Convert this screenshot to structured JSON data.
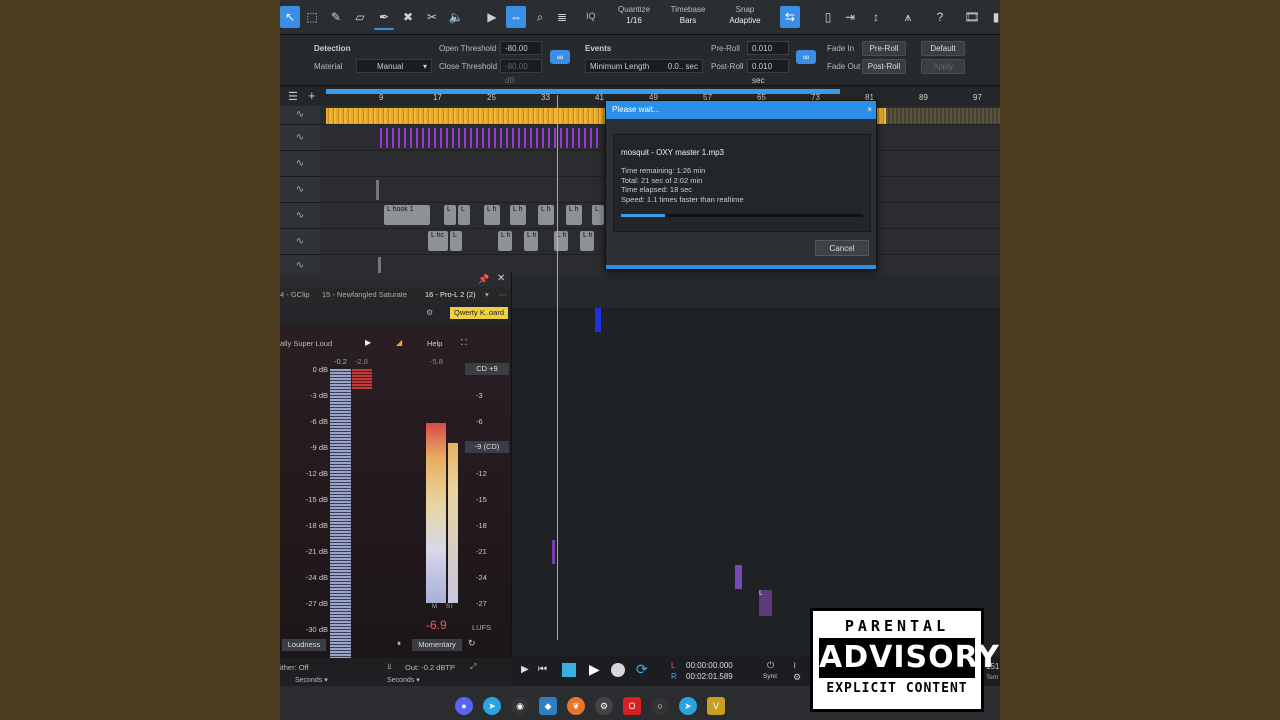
{
  "toolbar": {
    "iq": "IQ",
    "quantize_label": "Quantize",
    "quantize_value": "1/16",
    "timebase_label": "Timebase",
    "timebase_value": "Bars",
    "snap_label": "Snap",
    "snap_value": "Adaptive",
    "help": "?"
  },
  "detection": {
    "section": "Detection",
    "material_label": "Material",
    "material_value": "Manual",
    "open_threshold_label": "Open Threshold",
    "open_threshold_value": "-80.00 dB",
    "close_threshold_label": "Close Threshold",
    "close_threshold_value": "-80.00 dB"
  },
  "events": {
    "section": "Events",
    "min_length_label": "Minimum Length",
    "min_length_value": "0.0.. sec",
    "pre_roll_label": "Pre-Roll",
    "pre_roll_value": "0.010 sec",
    "post_roll_label": "Post-Roll",
    "post_roll_value": "0.010 sec",
    "fade_in_label": "Fade In",
    "fade_in_value": "Pre-Roll",
    "fade_out_label": "Fade Out",
    "fade_out_value": "Post-Roll",
    "default_btn": "Default",
    "apply_btn": "Apply"
  },
  "ruler": {
    "ticks": [
      "9",
      "17",
      "25",
      "33",
      "41",
      "49",
      "57",
      "65",
      "73",
      "81",
      "89",
      "97"
    ]
  },
  "clips": {
    "hook": "L hook 1",
    "l": "L",
    "lh": "L h",
    "lhc": "L hc"
  },
  "dialog": {
    "title": "Please wait...",
    "close": "×",
    "filename": "mosquit - OXY master 1.mp3",
    "time_remaining": "Time remaining: 1:26 min",
    "total": "Total: 21 sec of 2:02 min",
    "time_elapsed": "Time elapsed: 18 sec",
    "speed": "Speed: 1.1 times faster than realtime",
    "progress": 0.18,
    "cancel": "Cancel"
  },
  "plugin": {
    "tabs": [
      "4 - GClip",
      "15 - Newfangled Saturate",
      "16 - Pro-L 2 (2)"
    ],
    "preset_btn": "Qwerty K..oard",
    "preset_name": "ally Super Loud",
    "help": "Help",
    "peak_l": "-0.2",
    "peak_r": "-2.8",
    "loud_peak": "-5.8",
    "scale_left": [
      "0 dB",
      "-3 dB",
      "-6 dB",
      "-9 dB",
      "-12 dB",
      "-15 dB",
      "-18 dB",
      "-21 dB",
      "-24 dB",
      "-27 dB",
      "-30 dB"
    ],
    "scale_right": [
      "-3",
      "-6",
      "-12",
      "-15",
      "-18",
      "-21",
      "-24",
      "-27"
    ],
    "target_cd9": "CD +9",
    "target_9cd": "-9 (CD)",
    "lufs_value": "-6.9",
    "lufs_unit": "LUFS",
    "m_label": "M",
    "s_label": "S",
    "i_label": "I",
    "loudness_btn": "Loudness",
    "momentary_btn": "Momentary",
    "dither": "ither:  Off",
    "out": "Out: -0.2 dBTP",
    "seconds1": "Seconds",
    "seconds2": "Seconds"
  },
  "transport": {
    "l_label": "L",
    "r_label": "R",
    "l_time": "00:00:00.000",
    "r_time": "00:02:01.589",
    "sync": "Sync",
    "edge1": "151",
    "edge2": "Tem"
  },
  "advisory": {
    "line1": "PARENTAL",
    "line2": "ADVISORY",
    "line3": "EXPLICIT CONTENT"
  },
  "colors": {
    "accent": "#2b8fe8",
    "waveform": "#e8a82a",
    "midi": "#9a36d8",
    "background": "#4e3c1e"
  }
}
